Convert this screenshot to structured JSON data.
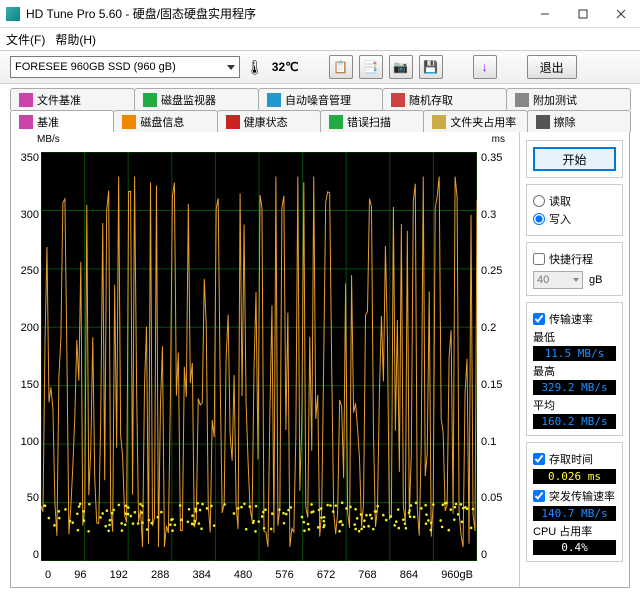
{
  "window": {
    "title": "HD Tune Pro 5.60 - 硬盘/固态硬盘实用程序",
    "menu": {
      "file": "文件(F)",
      "help": "帮助(H)"
    },
    "drive": "FORESEE 960GB SSD (960 gB)",
    "temperature": "32℃",
    "exit": "退出"
  },
  "tabs": {
    "row1": [
      {
        "label": "文件基准",
        "icon": "file-bench-icon"
      },
      {
        "label": "磁盘监视器",
        "icon": "monitor-icon"
      },
      {
        "label": "自动噪音管理",
        "icon": "noise-icon"
      },
      {
        "label": "随机存取",
        "icon": "random-icon"
      },
      {
        "label": "附加测试",
        "icon": "extra-icon"
      }
    ],
    "row2": [
      {
        "label": "基准",
        "icon": "bench-icon",
        "active": true
      },
      {
        "label": "磁盘信息",
        "icon": "info-icon"
      },
      {
        "label": "健康状态",
        "icon": "health-icon"
      },
      {
        "label": "错误扫描",
        "icon": "scan-icon"
      },
      {
        "label": "文件夹占用率",
        "icon": "folder-icon"
      },
      {
        "label": "擦除",
        "icon": "erase-icon"
      }
    ]
  },
  "sidebar": {
    "start": "开始",
    "read": "读取",
    "write": "写入",
    "shortstroke": "快捷行程",
    "shortval": "40",
    "shortunit": "gB",
    "transferrate": "传输速率",
    "min_lbl": "最低",
    "min_val": "11.5 MB/s",
    "max_lbl": "最高",
    "max_val": "329.2 MB/s",
    "avg_lbl": "平均",
    "avg_val": "160.2 MB/s",
    "accesstime": "存取时间",
    "access_val": "0.026 ms",
    "burst": "突发传输速率",
    "burst_val": "140.7 MB/s",
    "cpu": "CPU 占用率",
    "cpu_val": "0.4%"
  },
  "chart_data": {
    "type": "line",
    "xlabel": "gB",
    "ylabel_left": "MB/s",
    "ylabel_right": "ms",
    "xlim": [
      0,
      960
    ],
    "ylim_left": [
      0,
      350
    ],
    "ylim_right": [
      0,
      0.35
    ],
    "x_ticks": [
      0,
      96,
      192,
      288,
      384,
      480,
      576,
      672,
      768,
      864,
      "960gB"
    ],
    "y_ticks_left": [
      0,
      50,
      100,
      150,
      200,
      250,
      300,
      350
    ],
    "y_ticks_right": [
      0,
      0.05,
      0.1,
      0.15,
      0.2,
      0.25,
      0.3,
      0.35
    ],
    "series": [
      {
        "name": "transfer_speed_MBps",
        "note": "highly oscillating orange line, approx 200 samples; values swing between ~12 and ~330 MB/s across full 0–960gB range",
        "summary": {
          "min": 11.5,
          "max": 329.2,
          "avg": 160.2
        }
      },
      {
        "name": "access_time_ms",
        "note": "yellow scatter points clustered near 0.03–0.05 ms band across full range",
        "summary": {
          "avg": 0.026
        }
      }
    ]
  }
}
